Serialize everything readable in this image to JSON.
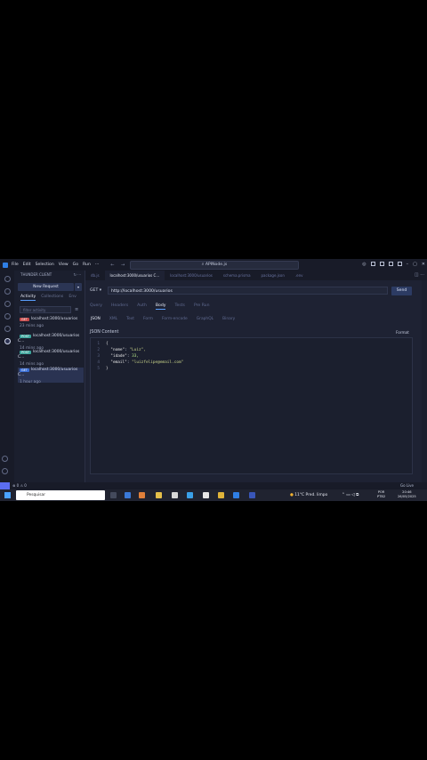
{
  "titlebar": {
    "menu": [
      "File",
      "Edit",
      "Selection",
      "View",
      "Go",
      "Run",
      "···"
    ],
    "search": "APINode.js"
  },
  "sidebar": {
    "title": "THUNDER CLIENT",
    "new_request": "New Request",
    "tabs": [
      "Activity",
      "Collections",
      "Env"
    ],
    "filter_placeholder": "filter activity",
    "requests": [
      {
        "method": "GET",
        "url": "localhost:3000/usuarios",
        "time": "23 mins ago",
        "color": "#c74a4a"
      },
      {
        "method": "POST",
        "url": "localhost:3000/usuarios C...",
        "time": "14 mins ago",
        "color": "#3ba49b"
      },
      {
        "method": "POST",
        "url": "localhost:3000/usuarios C...",
        "time": "14 mins ago",
        "color": "#3ba49b"
      },
      {
        "method": "GET",
        "url": "localhost:3000/usuarios C...",
        "time": "1 hour ago",
        "color": "#3b6fd6"
      }
    ]
  },
  "tabs": [
    "db.js",
    "localhost:3000/usuarios C...",
    "localhost:3000/usuarios",
    "schema.prisma",
    "package.json",
    ".env"
  ],
  "request": {
    "method": "GET",
    "url": "http://localhost:3000/usuarios",
    "send": "Send",
    "tabs": [
      "Query",
      "Headers",
      "Auth",
      "Body",
      "Tests",
      "Pre Run"
    ],
    "active_tab": "Body",
    "body_types": [
      "JSON",
      "XML",
      "Text",
      "Form",
      "Form-encode",
      "GraphQL",
      "Binary"
    ],
    "active_body_type": "JSON",
    "content_label": "JSON Content",
    "format": "Format"
  },
  "json_lines": [
    {
      "n": "1",
      "text": "{"
    },
    {
      "n": "2",
      "key": "\"nome\"",
      "val": "\"Luiz\","
    },
    {
      "n": "3",
      "key": "\"idade\"",
      "val": "33,"
    },
    {
      "n": "4",
      "key": "\"email\"",
      "val": "\"luizfelipe@email.com\""
    },
    {
      "n": "5",
      "text": "}"
    }
  ],
  "statusbar": {
    "left": "⊗ 0 ⚠ 0",
    "right": "Go Live"
  },
  "taskbar": {
    "search": "Pesquisar",
    "weather": "11°C  Pred. limpo",
    "lang": "POR",
    "lang2": "PTB2",
    "time": "20:46",
    "date": "26/05/2025"
  },
  "colors": {
    "accent": "#5aa0ff",
    "background": "#1e2233"
  }
}
